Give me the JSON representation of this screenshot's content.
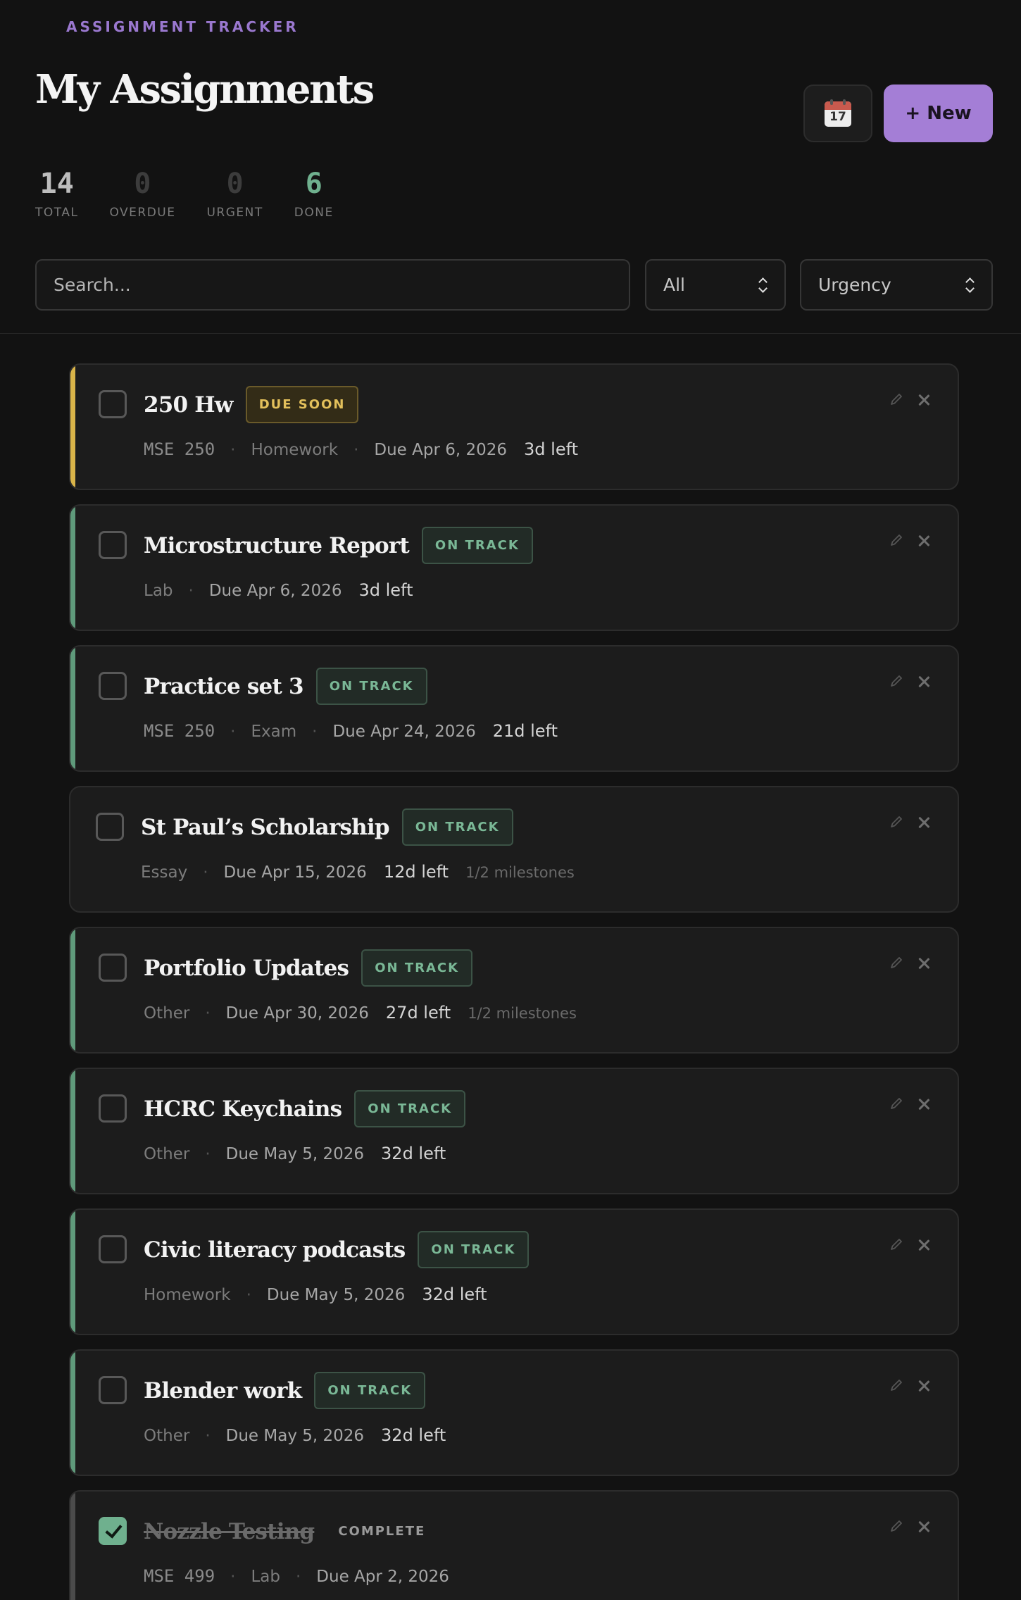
{
  "header": {
    "app_label": "ASSIGNMENT TRACKER",
    "title": "My Assignments",
    "calendar_day": "17",
    "new_button": "+ New"
  },
  "stats": [
    {
      "value": "14",
      "label": "TOTAL"
    },
    {
      "value": "0",
      "label": "OVERDUE"
    },
    {
      "value": "0",
      "label": "URGENT"
    },
    {
      "value": "6",
      "label": "DONE"
    }
  ],
  "filters": {
    "search_placeholder": "Search...",
    "status_value": "All",
    "sort_value": "Urgency"
  },
  "colors": {
    "accent_purple": "#a47ed6",
    "due_soon": "#e3c05b",
    "on_track": "#7ab896",
    "done": "#6fb08e"
  },
  "assignments": [
    {
      "title": "250 Hw",
      "badge": "DUE SOON",
      "course": "MSE 250",
      "type": "Homework",
      "due": "Due Apr 6, 2026",
      "left": "3d left",
      "milestones": ""
    },
    {
      "title": "Microstructure Report",
      "badge": "ON TRACK",
      "course": "",
      "type": "Lab",
      "due": "Due Apr 6, 2026",
      "left": "3d left",
      "milestones": ""
    },
    {
      "title": "Practice set 3",
      "badge": "ON TRACK",
      "course": "MSE 250",
      "type": "Exam",
      "due": "Due Apr 24, 2026",
      "left": "21d left",
      "milestones": ""
    },
    {
      "title": "St Paul’s Scholarship",
      "badge": "ON TRACK",
      "course": "",
      "type": "Essay",
      "due": "Due Apr 15, 2026",
      "left": "12d left",
      "milestones": "1/2 milestones"
    },
    {
      "title": "Portfolio Updates",
      "badge": "ON TRACK",
      "course": "",
      "type": "Other",
      "due": "Due Apr 30, 2026",
      "left": "27d left",
      "milestones": "1/2 milestones"
    },
    {
      "title": "HCRC Keychains",
      "badge": "ON TRACK",
      "course": "",
      "type": "Other",
      "due": "Due May 5, 2026",
      "left": "32d left",
      "milestones": ""
    },
    {
      "title": "Civic literacy podcasts",
      "badge": "ON TRACK",
      "course": "",
      "type": "Homework",
      "due": "Due May 5, 2026",
      "left": "32d left",
      "milestones": ""
    },
    {
      "title": "Blender work",
      "badge": "ON TRACK",
      "course": "",
      "type": "Other",
      "due": "Due May 5, 2026",
      "left": "32d left",
      "milestones": ""
    },
    {
      "title": "Nozzle Testing",
      "badge": "COMPLETE",
      "course": "MSE 499",
      "type": "Lab",
      "due": "Due Apr 2, 2026",
      "left": "",
      "milestones": ""
    }
  ]
}
